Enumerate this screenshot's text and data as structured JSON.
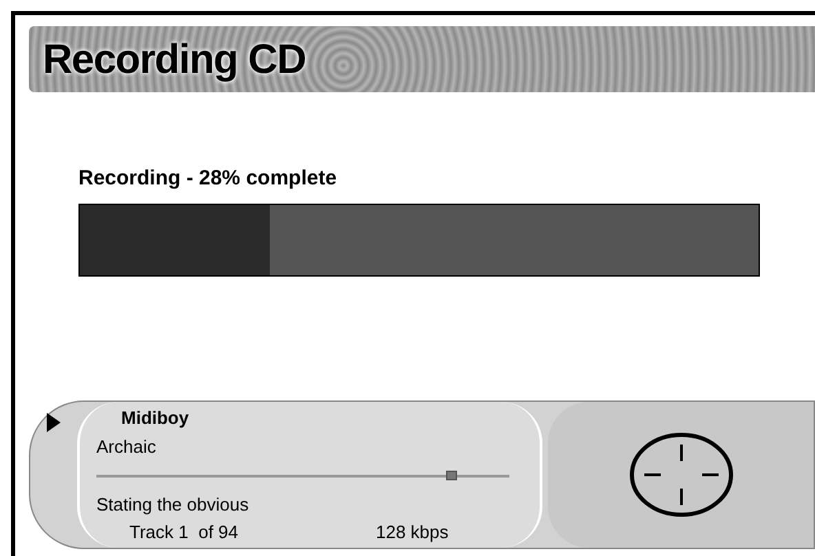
{
  "title": "Recording CD",
  "progress": {
    "label": "Recording - 28% complete",
    "level": 0.28
  },
  "player": {
    "artist": "Midiboy",
    "album": "Archaic",
    "position": {
      "level": 0.86
    },
    "song": "Stating the obvious",
    "track": "Track 1  of 94",
    "bitrate": "128 kbps"
  }
}
